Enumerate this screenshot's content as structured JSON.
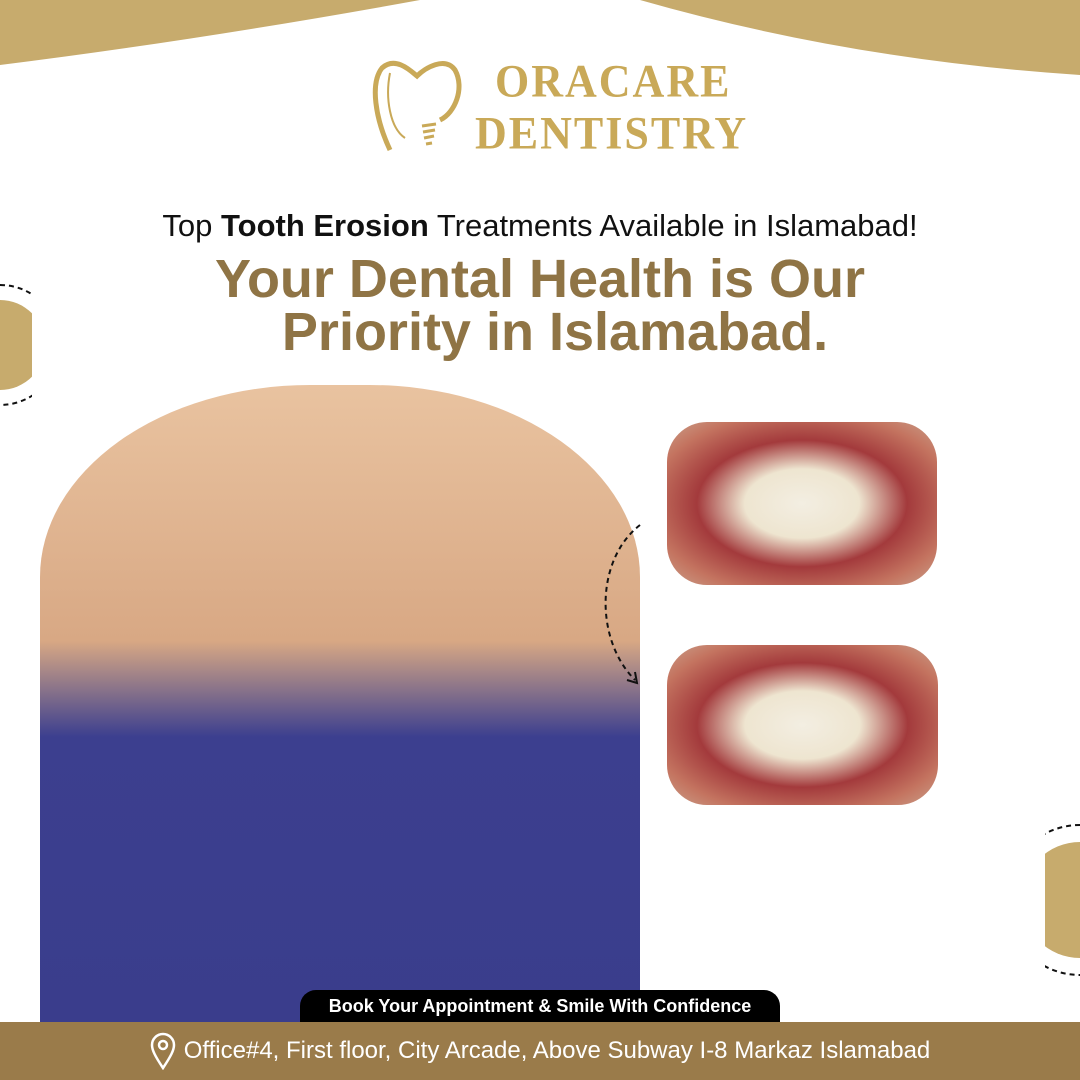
{
  "brand": {
    "line1": "ORACARE",
    "line2": "DENTISTRY",
    "icon": "tooth-implant-icon"
  },
  "headline": {
    "prefix": "Top ",
    "bold": "Tooth Erosion",
    "suffix": " Treatments Available in Islamabad!"
  },
  "title": {
    "line1": "Your Dental Health is Our",
    "line2": "Priority in Islamabad."
  },
  "cta": "Book Your Appointment & Smile With Confidence",
  "footer": {
    "address": "Office#4, First floor, City Arcade, Above Subway I-8 Markaz Islamabad",
    "icon": "location-pin-icon"
  },
  "colors": {
    "gold": "#c7ab6d",
    "brown": "#9a7b4a",
    "title": "#8f7445"
  }
}
